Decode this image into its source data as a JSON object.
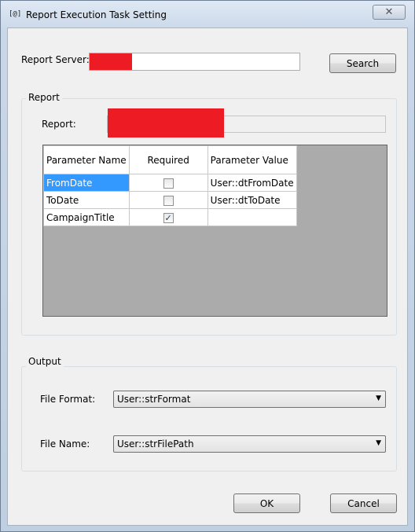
{
  "window": {
    "title": "Report Execution Task Setting",
    "icon_text": "[@]",
    "close_glyph": "✕"
  },
  "server": {
    "label": "Report Server:",
    "value": "",
    "search_label": "Search"
  },
  "report_group": {
    "title": "Report",
    "report_label": "Report:",
    "report_value": ""
  },
  "params": {
    "headers": [
      "Parameter Name",
      "Required",
      "Parameter Value"
    ],
    "rows": [
      {
        "name": "FromDate",
        "required": false,
        "value": "User::dtFromDate"
      },
      {
        "name": "ToDate",
        "required": false,
        "value": "User::dtToDate"
      },
      {
        "name": "CampaignTitle",
        "required": true,
        "value": ""
      }
    ]
  },
  "output_group": {
    "title": "Output",
    "file_format_label": "File Format:",
    "file_format_value": "User::strFormat",
    "file_name_label": "File Name:",
    "file_name_value": "User::strFilePath"
  },
  "buttons": {
    "ok": "OK",
    "cancel": "Cancel"
  },
  "colors": {
    "redaction": "#ed1c24",
    "selection": "#3399ff"
  }
}
